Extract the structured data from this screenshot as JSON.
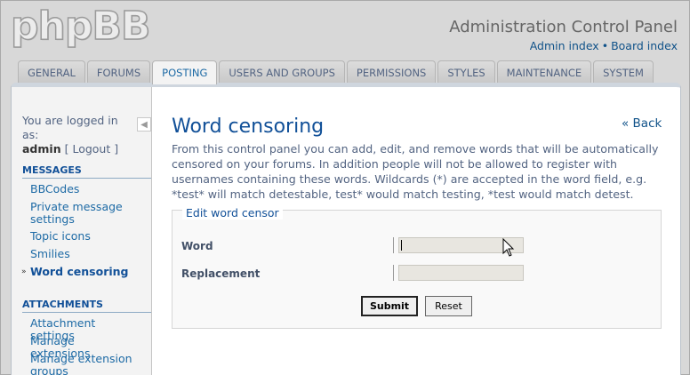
{
  "header": {
    "logo_text": "phpBB",
    "acp_title": "Administration Control Panel",
    "admin_index": "Admin index",
    "separator": "•",
    "board_index": "Board index"
  },
  "tabs": [
    {
      "label": "GENERAL"
    },
    {
      "label": "FORUMS"
    },
    {
      "label": "POSTING",
      "active": true
    },
    {
      "label": "USERS AND GROUPS"
    },
    {
      "label": "PERMISSIONS"
    },
    {
      "label": "STYLES"
    },
    {
      "label": "MAINTENANCE"
    },
    {
      "label": "SYSTEM"
    }
  ],
  "sidebar": {
    "logged_in_text": "You are logged in as:",
    "username": "admin",
    "logout_open": "[",
    "logout_label": "Logout",
    "logout_close": "]",
    "collapse_icon": "◀",
    "sections": [
      {
        "title": "MESSAGES",
        "items": [
          "BBCodes",
          "Private message settings",
          "Topic icons",
          "Smilies",
          "Word censoring"
        ]
      },
      {
        "title": "ATTACHMENTS",
        "items": [
          "Attachment settings",
          "Manage extensions",
          "Manage extension groups"
        ]
      }
    ],
    "active_bullet": "»"
  },
  "content": {
    "back_label": "« Back",
    "title": "Word censoring",
    "intro": "From this control panel you can add, edit, and remove words that will be automatically censored on your forums. In addition people will not be allowed to register with usernames containing these words. Wildcards (*) are accepted in the word field, e.g. *test* will match detestable, test* would match testing, *test would match detest.",
    "fieldset_legend": "Edit word censor",
    "word_label": "Word",
    "word_value": "",
    "replacement_label": "Replacement",
    "replacement_value": "",
    "submit_label": "Submit",
    "reset_label": "Reset"
  },
  "colors": {
    "link": "#105289",
    "title": "#115098",
    "body_text": "#536482",
    "background": "#d8d8d8"
  }
}
